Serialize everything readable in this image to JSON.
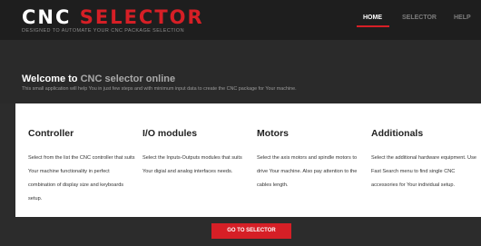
{
  "brand": {
    "logo_white": "CNC",
    "logo_red": "SELECTOR",
    "tagline": "DESIGNED TO AUTOMATE YOUR CNC PACKAGE SELECTION"
  },
  "nav": {
    "items": [
      {
        "label": "HOME",
        "active": true
      },
      {
        "label": "SELECTOR",
        "active": false
      },
      {
        "label": "HELP",
        "active": false
      }
    ]
  },
  "hero": {
    "title_prefix": "Welcome to",
    "title_accent": "CNC selector online",
    "subtitle": "This small application will help You in just few steps and with minimum input data to create the CNC package for Your machine."
  },
  "columns": [
    {
      "title": "Controller",
      "text": "Select from the list the CNC controller that suits Your machine functionality in perfect combination of display size and keyboards setup."
    },
    {
      "title": "I/O modules",
      "text": "Select the Inputs-Outputs modules that suits Your digial and analog interfaces needs."
    },
    {
      "title": "Motors",
      "text": "Select the axis motors and spindle motors to drive Your machine. Also pay attention to the cables length."
    },
    {
      "title": "Additionals",
      "text": "Select the additional hardware equipment. Use Fast Search menu to find single CNC accessories for Your individual setup."
    }
  ],
  "cta": {
    "label": "GO TO SELECTOR"
  },
  "colors": {
    "accent": "#d61f26",
    "header_bg": "#1e1e1e",
    "page_bg": "#2c2c2c",
    "panel_bg": "#ffffff"
  }
}
